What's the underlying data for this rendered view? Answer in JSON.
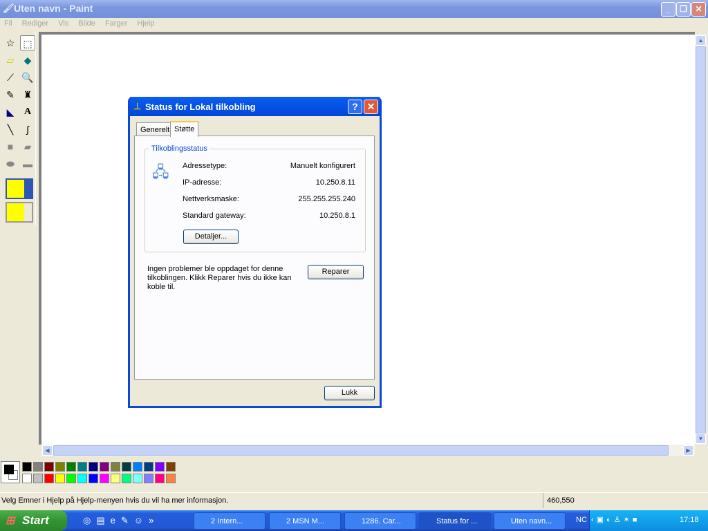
{
  "paint": {
    "title": "Uten navn - Paint",
    "menu": [
      "Fil",
      "Rediger",
      "Vis",
      "Bilde",
      "Farger",
      "Hjelp"
    ],
    "status_text": "Velg Emner i Hjelp på Hjelp-menyen hvis du vil ha mer informasjon.",
    "coords": "460,550",
    "tools": [
      "free-form-select",
      "select",
      "eraser",
      "fill",
      "pick-color",
      "magnifier",
      "pencil",
      "brush",
      "airbrush",
      "text",
      "line",
      "curve",
      "rectangle",
      "polygon",
      "ellipse",
      "rounded-rectangle"
    ],
    "palette_top": [
      "#000000",
      "#808080",
      "#800000",
      "#808000",
      "#008000",
      "#008080",
      "#000080",
      "#800080",
      "#808040",
      "#004040",
      "#0080ff",
      "#004080",
      "#8000ff",
      "#804000"
    ],
    "palette_bottom": [
      "#ffffff",
      "#c0c0c0",
      "#ff0000",
      "#ffff00",
      "#00ff00",
      "#00ffff",
      "#0000ff",
      "#ff00ff",
      "#ffff80",
      "#00ff80",
      "#80ffff",
      "#8080ff",
      "#ff0080",
      "#ff8040"
    ]
  },
  "dialog": {
    "title": "Status for Lokal tilkobling",
    "tabs": [
      "Generelt",
      "Støtte"
    ],
    "group_title": "Tilkoblingsstatus",
    "rows": [
      {
        "label": "Adressetype:",
        "value": "Manuelt konfigurert"
      },
      {
        "label": "IP-adresse:",
        "value": "10.250.8.11"
      },
      {
        "label": "Nettverksmaske:",
        "value": "255.255.255.240"
      },
      {
        "label": "Standard gateway:",
        "value": "10.250.8.1"
      }
    ],
    "details_button": "Detaljer...",
    "message": "Ingen problemer ble oppdaget for denne tilkoblingen. Klikk Reparer hvis du ikke kan koble til.",
    "repair_button": "Reparer",
    "close_button": "Lukk"
  },
  "taskbar": {
    "start": "Start",
    "tasks": [
      "2 Intern...",
      "2 MSN M...",
      "1286. Car...",
      "Status for ...",
      "Uten navn..."
    ],
    "tray_text": "NC",
    "clock": "17:18"
  }
}
